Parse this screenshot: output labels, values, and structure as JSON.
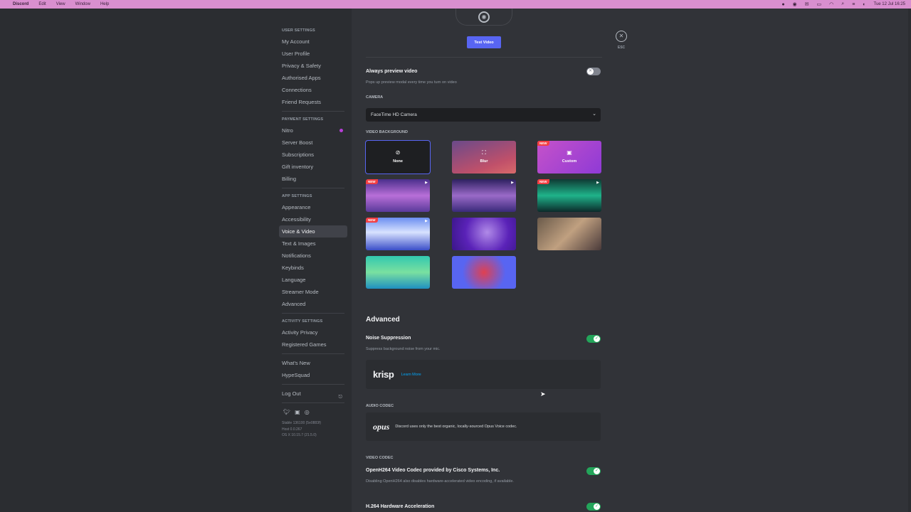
{
  "menubar": {
    "app": "Discord",
    "items": [
      "Edit",
      "View",
      "Window",
      "Help"
    ],
    "clock": "Tue 12 Jul  16:25"
  },
  "sidebar": {
    "user_settings_header": "USER SETTINGS",
    "user_settings": [
      "My Account",
      "User Profile",
      "Privacy & Safety",
      "Authorised Apps",
      "Connections",
      "Friend Requests"
    ],
    "payment_settings_header": "PAYMENT SETTINGS",
    "payment_settings": [
      "Nitro",
      "Server Boost",
      "Subscriptions",
      "Gift inventory",
      "Billing"
    ],
    "app_settings_header": "APP SETTINGS",
    "app_settings": [
      "Appearance",
      "Accessibility",
      "Voice & Video",
      "Text & Images",
      "Notifications",
      "Keybinds",
      "Language",
      "Streamer Mode",
      "Advanced"
    ],
    "activity_settings_header": "ACTIVITY SETTINGS",
    "activity_settings": [
      "Activity Privacy",
      "Registered Games"
    ],
    "misc": [
      "What's New",
      "HypeSquad"
    ],
    "logout": "Log Out",
    "version_lines": [
      "Stable 136100 (5e0883f)",
      "Host 0.0.267",
      "OS X 10.15.7 (21.5.0)"
    ]
  },
  "video": {
    "test_video_label": "Test Video",
    "always_preview_title": "Always preview video",
    "always_preview_desc": "Pops up preview modal every time you turn on video",
    "camera_label": "CAMERA",
    "camera_value": "FaceTime HD Camera",
    "background_label": "VIDEO BACKGROUND",
    "tile_none": "None",
    "tile_blur": "Blur",
    "tile_custom": "Custom",
    "new_badge": "NEW"
  },
  "advanced": {
    "title": "Advanced",
    "noise_title": "Noise Suppression",
    "noise_desc": "Suppress background noise from your mic.",
    "krisp": "krisp",
    "learn_more": "Learn More",
    "audio_codec_label": "AUDIO CODEC",
    "opus": "opus",
    "opus_desc": "Discord uses only the best organic, locally-sourced Opus Voice codec.",
    "video_codec_label": "VIDEO CODEC",
    "openh264_title": "OpenH264 Video Codec provided by Cisco Systems, Inc.",
    "openh264_desc": "Disabling OpenH264 also disables hardware-accelerated video encoding, if available.",
    "h264_title": "H.264 Hardware Acceleration"
  },
  "close": {
    "esc": "ESC"
  },
  "colors": {
    "accent": "#5865f2",
    "toggle_on": "#23a55a",
    "badge": "#f23f43"
  }
}
